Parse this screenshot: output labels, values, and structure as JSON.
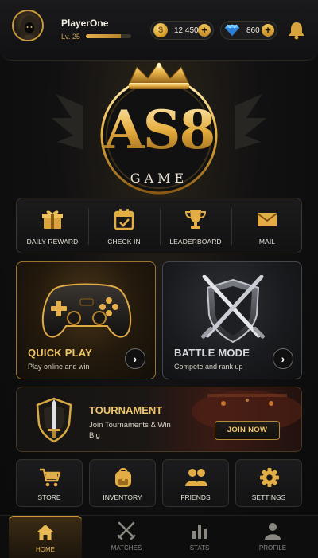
{
  "header": {
    "player_name": "PlayerOne",
    "level": "Lv. 25",
    "xp_progress": 0.78,
    "coins": "12,450",
    "gems": "860",
    "coin_icon": "dollar-coin-icon",
    "gem_icon": "diamond-icon",
    "notification_icon": "bell-icon"
  },
  "logo": {
    "brand": "AS8",
    "sub": "GAME"
  },
  "quick_menu": {
    "items": [
      {
        "label": "DAILY REWARD",
        "icon": "gift-icon"
      },
      {
        "label": "CHECK IN",
        "icon": "calendar-check-icon"
      },
      {
        "label": "LEADERBOARD",
        "icon": "trophy-icon"
      },
      {
        "label": "MAIL",
        "icon": "envelope-icon"
      }
    ]
  },
  "modes": {
    "quick_play": {
      "title": "QUICK PLAY",
      "subtitle": "Play online and win",
      "icon": "gamepad-icon"
    },
    "battle_mode": {
      "title": "BATTLE MODE",
      "subtitle": "Compete and rank up",
      "icon": "crossed-swords-shield-icon"
    }
  },
  "tournament": {
    "title": "TOURNAMENT",
    "subtitle": "Join Tournaments & Win Big",
    "button": "JOIN NOW",
    "icon": "sword-shield-icon"
  },
  "grid": {
    "items": [
      {
        "label": "STORE",
        "icon": "cart-icon"
      },
      {
        "label": "INVENTORY",
        "icon": "backpack-icon"
      },
      {
        "label": "FRIENDS",
        "icon": "users-icon"
      },
      {
        "label": "SETTINGS",
        "icon": "gear-icon"
      }
    ]
  },
  "nav": {
    "items": [
      {
        "label": "HOME",
        "icon": "home-icon",
        "active": true
      },
      {
        "label": "MATCHES",
        "icon": "crossed-swords-icon"
      },
      {
        "label": "STATS",
        "icon": "bar-chart-icon"
      },
      {
        "label": "PROFILE",
        "icon": "person-icon"
      }
    ]
  },
  "colors": {
    "accent_gold": "#e1b04f",
    "background": "#0b0b0d",
    "card_border_gold": "#9c7430"
  }
}
